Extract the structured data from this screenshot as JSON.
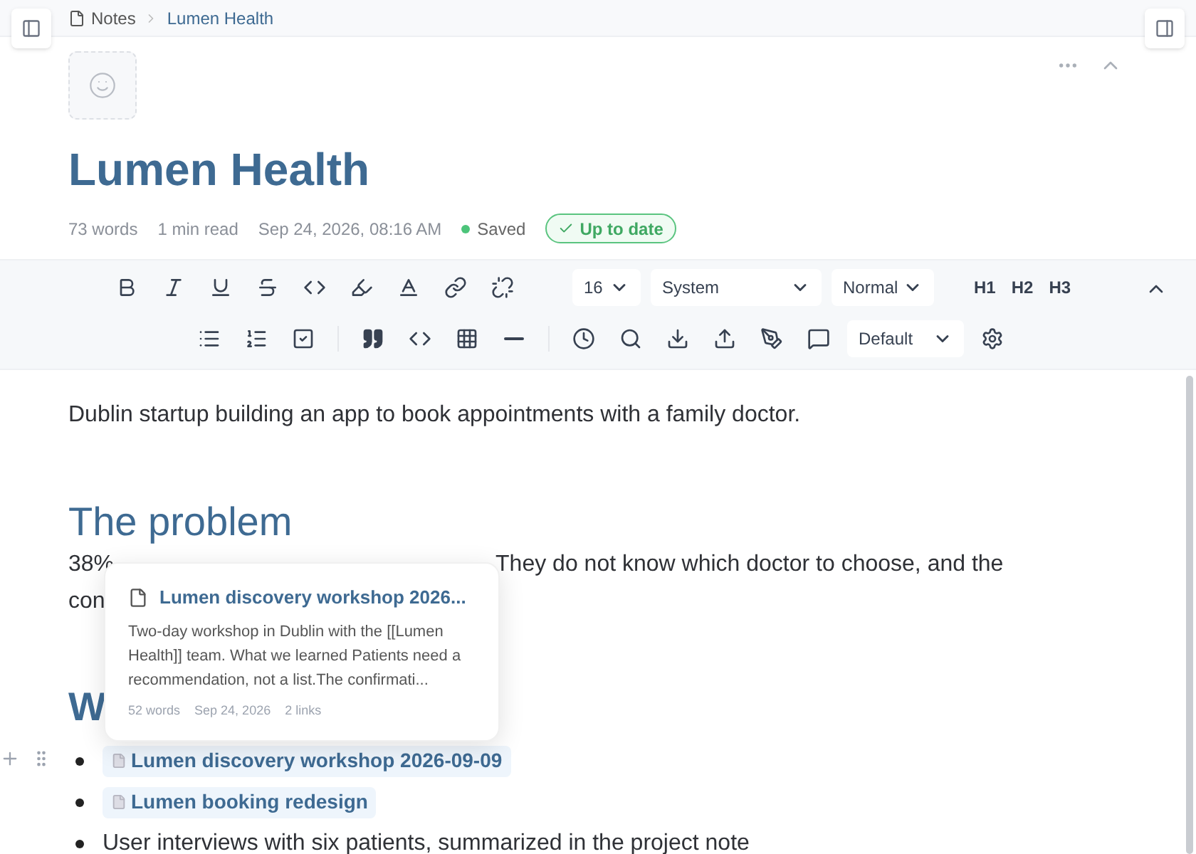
{
  "breadcrumb": [
    {
      "label": "Notes"
    },
    {
      "label": "Lumen Health"
    }
  ],
  "title": "Lumen Health",
  "meta": {
    "words": "73 words",
    "read_time": "1 min read",
    "date": "Sep 24, 2026, 08:16 AM",
    "save_status": "Saved",
    "sync_badge": "Up to date"
  },
  "toolbar": {
    "font_size": "16",
    "font": "System",
    "style": "Normal",
    "headings": [
      "H1",
      "H2",
      "H3"
    ],
    "theme": "Default"
  },
  "content": [
    {
      "kind": "paragraph",
      "text": "Dublin startup building an app to book appointments with a family doctor."
    },
    {
      "kind": "heading",
      "text": "The problem"
    },
    {
      "kind": "covered_paragraph",
      "lines": [
        [
          "38%",
          "They do not know which doctor to choose, and the"
        ],
        [
          "con"
        ]
      ]
    },
    {
      "kind": "covered_heading",
      "text": "W"
    },
    {
      "kind": "list",
      "items": [
        {
          "kind": "link",
          "text": "Lumen discovery workshop 2026-09-09"
        },
        {
          "kind": "link",
          "text": "Lumen booking redesign"
        },
        {
          "kind": "text",
          "text": "User interviews with six patients, summarized in the project note"
        }
      ]
    }
  ],
  "popover": {
    "title": "Lumen discovery workshop 2026...",
    "excerpt": "Two-day workshop in Dublin with the [[Lumen Health]] team. What we learned Patients need a recommendation, not a list.The confirmati...",
    "meta": [
      "52 words",
      "Sep 24, 2026",
      "2 links"
    ]
  }
}
